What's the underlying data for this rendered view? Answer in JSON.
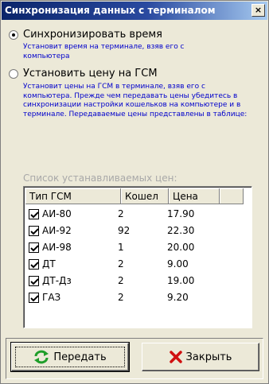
{
  "window": {
    "title": "Синхронизация данных с терминалом",
    "close_label": "×"
  },
  "options": [
    {
      "label": "Синхронизировать время",
      "description": "Установит время на терминале, взяв его с компьютера",
      "selected": true
    },
    {
      "label": "Установить цену на ГСМ",
      "description": "Установит цены на ГСМ в терминале, взяв его с компьютера. Прежде чем передавать цены убедитесь в синхронизации настройки кошельков на компьютере и в терминале. Передаваемые цены представлены в таблице:",
      "selected": false
    }
  ],
  "price_list": {
    "caption": "Список устанавливаемых цен:",
    "columns": [
      "Тип ГСМ",
      "Кошел",
      "Цена"
    ],
    "rows": [
      {
        "name": "АИ-80",
        "wallet": "2",
        "price": "17.90",
        "checked": true
      },
      {
        "name": "АИ-92",
        "wallet": "92",
        "price": "22.30",
        "checked": true
      },
      {
        "name": "АИ-98",
        "wallet": "1",
        "price": "20.00",
        "checked": true
      },
      {
        "name": "ДТ",
        "wallet": "2",
        "price": "9.00",
        "checked": true
      },
      {
        "name": "ДТ-Дз",
        "wallet": "2",
        "price": "19.00",
        "checked": true
      },
      {
        "name": "ГАЗ",
        "wallet": "2",
        "price": "9.20",
        "checked": true
      }
    ]
  },
  "buttons": {
    "send_label": "Передать",
    "close_label": "Закрыть"
  },
  "icons": {
    "send": "refresh-arrows-icon",
    "close": "red-x-icon"
  },
  "colors": {
    "title_start": "#0a246a",
    "title_end": "#a6caf0",
    "description_text": "#0000cc",
    "caption_disabled": "#a8a8a8",
    "send_icon": "#1f9e2a",
    "close_icon": "#d01010"
  }
}
